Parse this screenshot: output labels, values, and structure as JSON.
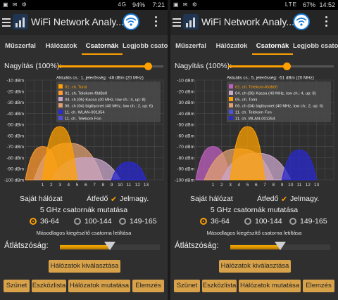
{
  "colors": {
    "accent": "#ffa000",
    "button": "#d8a24a",
    "panel": "#2f2f2f"
  },
  "panels": [
    {
      "status": {
        "time": "7:21",
        "battery": "94%",
        "signal": "4G"
      },
      "app": {
        "title": "WiFi Network Analy...",
        "menu_icon": "hamburger-icon",
        "wifi_icon": "wifi-icon",
        "more_icon": "kebab-icon"
      },
      "tabs": [
        "Műszerfal",
        "Hálózatok",
        "Csatornák",
        "Legjobb csator..."
      ],
      "active_tab": 2,
      "zoom_label": "Nagyítás (100%):",
      "zoom_value": 0.85,
      "chart_data": {
        "type": "area",
        "info": "Aktuális cs.: 1, jelerősség: -46 dBm (20 MHz)",
        "y_ticks": [
          "-10 dBm",
          "-20 dBm",
          "-30 dBm",
          "-40 dBm",
          "-50 dBm",
          "-60 dBm",
          "-70 dBm",
          "-80 dBm",
          "-90 dBm",
          "-100 dBm"
        ],
        "x_ticks": [
          "1",
          "2",
          "3",
          "4",
          "5",
          "6",
          "7",
          "8",
          "9",
          "10",
          "11",
          "12",
          "13"
        ],
        "ylim": [
          -100,
          -10
        ],
        "legend": [
          {
            "label": "01. ch. Tomi",
            "color": "#ffa000"
          },
          {
            "label": "01. ch. Telekom-f0d8e0",
            "color": "#ff9a2e"
          },
          {
            "label": "04. ch (06) Kacsa (40 MHz, low ch.: 4, up: 8)",
            "color": "#c9a7c9"
          },
          {
            "label": "06. ch (04) bigibyonet (40 MHz, low ch.: 2, up: 6)",
            "color": "#e0a070"
          },
          {
            "label": "11. ch. WLAN-001354",
            "color": "#2a2ad0"
          },
          {
            "label": "11. ch. Telekom Fon",
            "color": "#5050e0"
          }
        ],
        "series": [
          {
            "name": "01. ch. Telekom-f0d8e0",
            "channel": 1,
            "width": 4,
            "dbm": -70,
            "color": "#ff9a2e"
          },
          {
            "name": "06. ch (04) bigibyonet (40 MHz, low ch.: 2, up: 6)",
            "channel": 4,
            "width": 8,
            "dbm": -67,
            "color": "#e0a070"
          },
          {
            "name": "04. ch (06) Kacsa (40 MHz, low ch.: 4, up: 8)",
            "channel": 6,
            "width": 8,
            "dbm": -80,
            "color": "#c9a7c9"
          },
          {
            "name": "01. ch. Tomi",
            "channel": 3,
            "width": 4,
            "dbm": -52,
            "color": "#ffa000"
          },
          {
            "name": "11. ch. WLAN-001354",
            "channel": 11,
            "width": 4,
            "dbm": -84,
            "color": "#2a2ad0"
          }
        ]
      },
      "own_network": "Saját hálózat",
      "overlap": "Átfedő",
      "marked": "Jelmagy.",
      "ghz_title": "5 GHz csatornák mutatása",
      "radios": [
        "36-64",
        "100-144",
        "149-165"
      ],
      "selected_radio": 0,
      "secondary": "Másodlagos kiegészítő csatorna letiltása",
      "transparency_label": "Átlátszóság:",
      "transparency_value": 0.5,
      "select_button": "Hálózatok kiválasztása",
      "bottom_buttons": [
        "Szünet",
        "Eszközlista",
        "Hálózatok mutatása",
        "Elemzés"
      ]
    },
    {
      "status": {
        "time": "14:52",
        "battery": "67%",
        "signal": "LTE"
      },
      "app": {
        "title": "WiFi Network Analy...",
        "menu_icon": "hamburger-icon",
        "wifi_icon": "wifi-icon",
        "more_icon": "kebab-icon"
      },
      "tabs": [
        "Műszerfal",
        "Hálózatok",
        "Csatornák",
        "Legjobb csator..."
      ],
      "active_tab": 2,
      "zoom_label": "Nagyítás (100%):",
      "zoom_value": 0.55,
      "chart_data": {
        "type": "area",
        "info": "Aktuális cs.: 5, jelerősség: -51 dBm (20 MHz)",
        "y_ticks": [
          "-10 dBm",
          "-20 dBm",
          "-30 dBm",
          "-40 dBm",
          "-50 dBm",
          "-60 dBm",
          "-70 dBm",
          "-80 dBm",
          "-90 dBm",
          "-100 dBm"
        ],
        "x_ticks": [
          "1",
          "2",
          "3",
          "4",
          "5",
          "6",
          "7",
          "8",
          "9",
          "10",
          "11",
          "12",
          "13"
        ],
        "ylim": [
          -100,
          -10
        ],
        "legend": [
          {
            "label": "01. ch. Telekom-f0d8e0",
            "color": "#c060c0"
          },
          {
            "label": "04. ch (06) Kacsa (40 MHz, low ch.: 4, up: 8)",
            "color": "#c9a7c9"
          },
          {
            "label": "05. ch. Tomi",
            "color": "#ffa000"
          },
          {
            "label": "06. ch (04) bigibyonet (40 MHz, low ch.: 2, up: 6)",
            "color": "#e0a070"
          },
          {
            "label": "11. ch. Telekom Fon",
            "color": "#5050e0"
          },
          {
            "label": "11. ch. WLAN-001354",
            "color": "#2a2ad0"
          }
        ],
        "series": [
          {
            "name": "01. ch. Telekom-f0d8e0",
            "channel": 1,
            "width": 4,
            "dbm": -70,
            "color": "#c060c0"
          },
          {
            "name": "06. ch (04) bigibyonet (40 MHz, low ch.: 2, up: 6)",
            "channel": 4,
            "width": 8,
            "dbm": -72,
            "color": "#e0a070"
          },
          {
            "name": "04. ch (06) Kacsa (40 MHz, low ch.: 4, up: 8)",
            "channel": 6,
            "width": 8,
            "dbm": -76,
            "color": "#c9a7c9"
          },
          {
            "name": "05. ch. Tomi",
            "channel": 5,
            "width": 4,
            "dbm": -52,
            "color": "#ffa000"
          },
          {
            "name": "11. ch. WLAN-001354",
            "channel": 11,
            "width": 4,
            "dbm": -73,
            "color": "#2a2ad0"
          }
        ]
      },
      "own_network": "Saját hálózat",
      "overlap": "Átfedő",
      "marked": "Jelmagy.",
      "ghz_title": "5 GHz csatornák mutatása",
      "radios": [
        "36-64",
        "100-144",
        "149-165"
      ],
      "selected_radio": 0,
      "secondary": "Másodlagos kiegészítő csatorna letiltása",
      "transparency_label": "Átlátszóság:",
      "transparency_value": 0.5,
      "select_button": "Hálózatok kiválasztása",
      "bottom_buttons": [
        "Szünet",
        "Eszközlista",
        "Hálózatok mutatása",
        "Elemzés"
      ]
    }
  ]
}
